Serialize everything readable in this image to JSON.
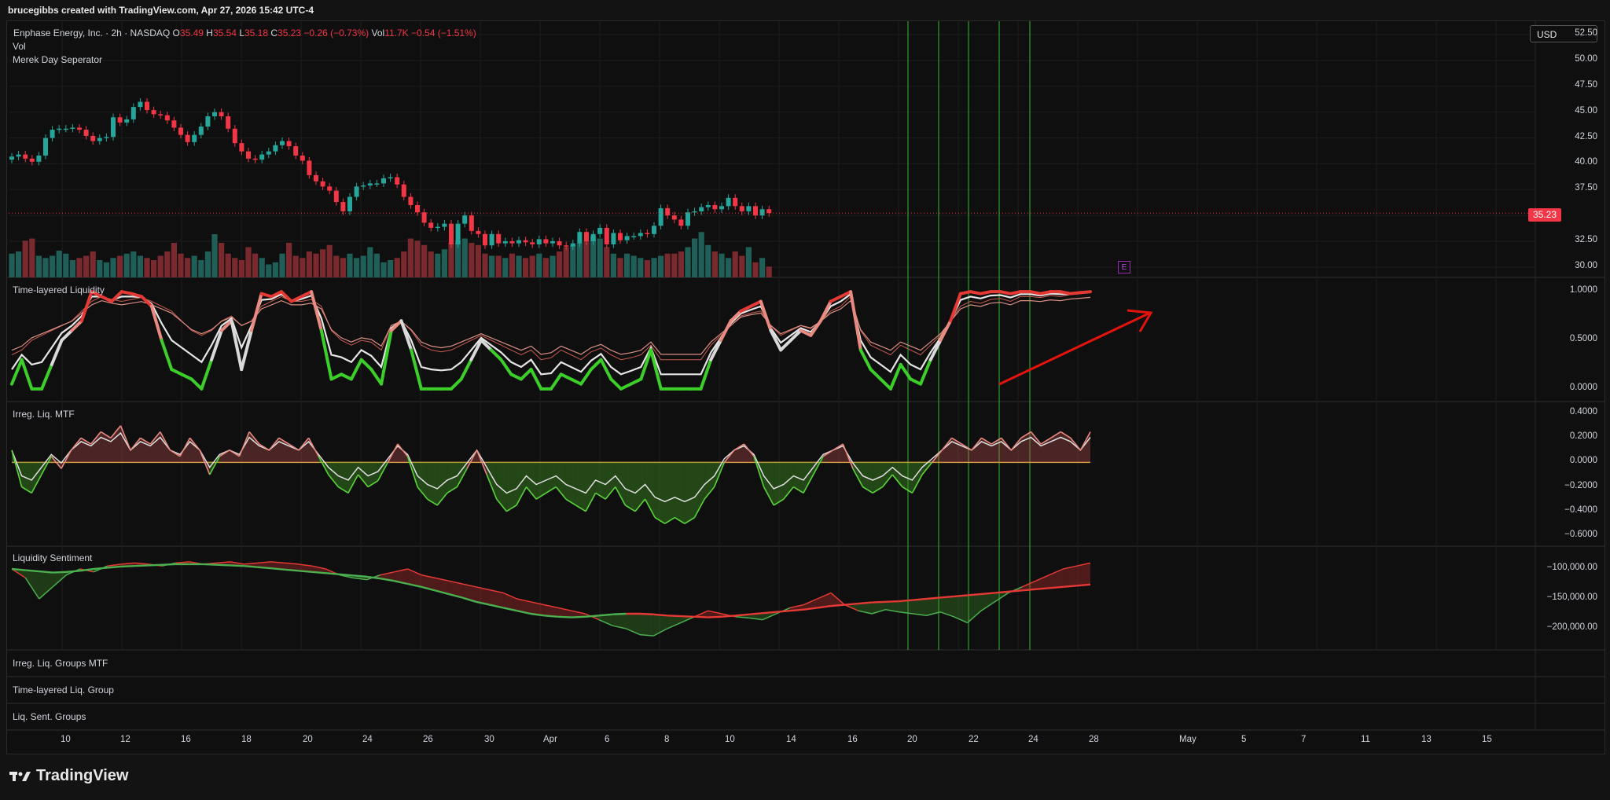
{
  "header": {
    "credit": "brucegibbs created with TradingView.com, Apr 27, 2026 15:42 UTC-4"
  },
  "symbol": {
    "name": "Enphase Energy, Inc. · 2h · NASDAQ",
    "o_label": "O",
    "o_value": "35.49",
    "h_label": "H",
    "h_value": "35.54",
    "l_label": "L",
    "l_value": "35.18",
    "c_label": "C",
    "c_value": "35.23",
    "change": "−0.26 (−0.73%)",
    "vol_label": "Vol",
    "vol_value": "11.7K",
    "vol_change": "−0.54 (−1.51%)"
  },
  "indicators": {
    "vol": "Vol",
    "day_sep": "Merek Day Seperator",
    "pane2": "Time-layered Liquidity",
    "pane3": "Irreg. Liq. MTF",
    "pane4": "Liquidity Sentiment",
    "pane5": "Irreg. Liq. Groups MTF",
    "pane6": "Time-layered Liq. Group",
    "pane7": "Liq. Sent. Groups"
  },
  "currency": "USD",
  "last_price": "35.23",
  "earnings_badge": "E",
  "footer": {
    "brand": "TradingView"
  },
  "colors": {
    "up": "#26a69a",
    "down": "#f23645",
    "green_line": "#4caf50",
    "red_line": "#e53935",
    "separator": "#2e9e2e"
  },
  "price_axis": [
    "52.50",
    "50.00",
    "47.50",
    "45.00",
    "42.50",
    "40.00",
    "37.50",
    "32.50",
    "30.00"
  ],
  "tl_axis": [
    "1.0000",
    "0.5000",
    "0.0000"
  ],
  "il_axis": [
    "0.4000",
    "0.2000",
    "0.0000",
    "−0.2000",
    "−0.4000",
    "−0.6000"
  ],
  "ls_axis": [
    "−100,000.00",
    "−150,000.00",
    "−200,000.00"
  ],
  "time_axis": [
    "10",
    "12",
    "16",
    "18",
    "20",
    "24",
    "26",
    "30",
    "Apr",
    "6",
    "8",
    "10",
    "14",
    "16",
    "20",
    "22",
    "24",
    "28",
    "May",
    "5",
    "7",
    "11",
    "13",
    "15"
  ],
  "chart_data": {
    "type": "candlestick",
    "title": "Enphase Energy, Inc. · 2h · NASDAQ",
    "xlabel": "",
    "ylabel": "",
    "ylim": [
      29.0,
      53.5
    ],
    "close": [
      40.7,
      40.9,
      40.5,
      40.2,
      40.8,
      42.5,
      43.3,
      43.4,
      43.4,
      43.5,
      43.3,
      42.7,
      42.2,
      42.5,
      42.6,
      44.5,
      44.0,
      44.3,
      45.5,
      46.0,
      45.2,
      44.8,
      44.7,
      44.2,
      43.5,
      42.8,
      42.1,
      42.8,
      43.6,
      44.6,
      45.0,
      44.6,
      43.4,
      42.0,
      41.2,
      40.5,
      40.4,
      40.9,
      41.2,
      41.8,
      42.2,
      41.7,
      40.8,
      40.3,
      38.9,
      38.3,
      37.8,
      37.4,
      36.3,
      35.4,
      36.8,
      37.8,
      37.9,
      38.1,
      38.1,
      38.6,
      38.7,
      38.0,
      36.8,
      36.0,
      35.3,
      34.3,
      33.8,
      33.9,
      34.2,
      32.2,
      34.2,
      35.0,
      33.5,
      33.2,
      32.1,
      33.2,
      32.3,
      32.5,
      32.3,
      32.6,
      32.4,
      32.2,
      32.7,
      32.3,
      32.5,
      32.1,
      32.0,
      32.3,
      33.4,
      32.5,
      33.2,
      33.8,
      32.2,
      33.3,
      32.6,
      33.0,
      33.0,
      33.3,
      33.2,
      34.0,
      35.7,
      35.0,
      34.6,
      34.0,
      35.3,
      35.4,
      35.8,
      36.0,
      35.6,
      35.9,
      36.7,
      35.9,
      35.4,
      35.9,
      35.0,
      35.6,
      35.23
    ],
    "volume_relative": [
      0.55,
      0.6,
      0.85,
      0.9,
      0.5,
      0.45,
      0.5,
      0.62,
      0.55,
      0.4,
      0.45,
      0.5,
      0.6,
      0.4,
      0.35,
      0.45,
      0.5,
      0.55,
      0.6,
      0.5,
      0.45,
      0.4,
      0.5,
      0.6,
      0.8,
      0.55,
      0.45,
      0.5,
      0.4,
      0.6,
      1.0,
      0.8,
      0.55,
      0.45,
      0.4,
      0.7,
      0.55,
      0.45,
      0.3,
      0.35,
      0.55,
      0.8,
      0.5,
      0.45,
      0.6,
      0.55,
      0.65,
      0.75,
      0.5,
      0.45,
      0.55,
      0.45,
      0.5,
      0.7,
      0.55,
      0.35,
      0.4,
      0.45,
      0.6,
      0.9,
      0.85,
      0.75,
      0.6,
      0.55,
      0.65,
      0.8,
      0.85,
      0.9,
      0.8,
      0.75,
      0.55,
      0.5,
      0.5,
      0.45,
      0.55,
      0.5,
      0.45,
      0.5,
      0.55,
      0.45,
      0.5,
      0.6,
      0.7,
      0.75,
      0.8,
      0.85,
      0.95,
      0.9,
      0.7,
      0.55,
      0.45,
      0.55,
      0.5,
      0.45,
      0.4,
      0.45,
      0.5,
      0.55,
      0.55,
      0.6,
      0.7,
      0.9,
      1.05,
      0.75,
      0.6,
      0.55,
      0.45,
      0.6,
      0.5,
      0.7,
      0.35,
      0.45,
      0.25
    ],
    "last_price": 35.23,
    "separator_dates": [
      "20",
      "21",
      "22",
      "23",
      "24"
    ],
    "time_layered_liquidity": {
      "ylim": [
        -0.05,
        1.05
      ],
      "thick": [
        0.05,
        0.3,
        0.0,
        0.0,
        0.25,
        0.5,
        0.6,
        0.7,
        1.0,
        0.95,
        0.9,
        1.0,
        0.98,
        0.95,
        0.85,
        0.5,
        0.2,
        0.15,
        0.1,
        0.0,
        0.3,
        0.6,
        0.7,
        0.2,
        0.6,
        0.98,
        0.95,
        1.0,
        0.9,
        0.95,
        1.0,
        0.6,
        0.1,
        0.15,
        0.1,
        0.3,
        0.2,
        0.05,
        0.6,
        0.7,
        0.4,
        0.0,
        0.0,
        0.0,
        0.0,
        0.1,
        0.3,
        0.5,
        0.4,
        0.3,
        0.15,
        0.1,
        0.2,
        0.0,
        0.0,
        0.15,
        0.1,
        0.05,
        0.2,
        0.3,
        0.1,
        0.0,
        0.05,
        0.1,
        0.4,
        0.0,
        0.0,
        0.0,
        0.0,
        0.0,
        0.3,
        0.5,
        0.7,
        0.8,
        0.85,
        0.9,
        0.6,
        0.4,
        0.5,
        0.6,
        0.55,
        0.7,
        0.9,
        0.95,
        1.0,
        0.4,
        0.2,
        0.1,
        0.0,
        0.25,
        0.1,
        0.05,
        0.3,
        0.5,
        0.7,
        0.98,
        1.0,
        0.98,
        1.0,
        1.0,
        0.98,
        1.0,
        1.0,
        0.98,
        1.0,
        1.0,
        0.98,
        0.99,
        1.0
      ],
      "thin_a": [
        0.35,
        0.4,
        0.5,
        0.55,
        0.6,
        0.65,
        0.7,
        0.8,
        0.9,
        0.95,
        0.92,
        0.9,
        0.92,
        0.94,
        0.9,
        0.85,
        0.8,
        0.7,
        0.6,
        0.55,
        0.6,
        0.7,
        0.75,
        0.65,
        0.7,
        0.85,
        0.9,
        0.95,
        0.9,
        0.9,
        0.92,
        0.85,
        0.6,
        0.5,
        0.45,
        0.5,
        0.48,
        0.4,
        0.65,
        0.7,
        0.6,
        0.45,
        0.4,
        0.38,
        0.4,
        0.45,
        0.5,
        0.55,
        0.5,
        0.45,
        0.4,
        0.35,
        0.4,
        0.3,
        0.32,
        0.4,
        0.35,
        0.3,
        0.38,
        0.42,
        0.35,
        0.3,
        0.32,
        0.35,
        0.45,
        0.3,
        0.3,
        0.3,
        0.3,
        0.3,
        0.45,
        0.55,
        0.65,
        0.75,
        0.78,
        0.8,
        0.65,
        0.55,
        0.6,
        0.65,
        0.62,
        0.7,
        0.8,
        0.85,
        0.95,
        0.6,
        0.45,
        0.4,
        0.35,
        0.45,
        0.4,
        0.35,
        0.45,
        0.55,
        0.7,
        0.85,
        0.9,
        0.88,
        0.92,
        0.93,
        0.9,
        0.95,
        0.95,
        0.94,
        0.96,
        0.95,
        0.97,
        0.98,
        0.99
      ]
    },
    "irreg_liq_mtf": {
      "ylim": [
        -0.62,
        0.42
      ],
      "main": [
        0.1,
        -0.2,
        -0.25,
        -0.1,
        0.05,
        -0.05,
        0.1,
        0.2,
        0.15,
        0.25,
        0.2,
        0.3,
        0.1,
        0.2,
        0.15,
        0.25,
        0.1,
        0.05,
        0.2,
        0.1,
        -0.1,
        0.05,
        0.1,
        0.05,
        0.25,
        0.15,
        0.1,
        0.2,
        0.15,
        0.1,
        0.2,
        0.05,
        -0.1,
        -0.2,
        -0.25,
        -0.1,
        -0.2,
        -0.15,
        0.0,
        0.15,
        0.05,
        -0.2,
        -0.3,
        -0.35,
        -0.25,
        -0.2,
        -0.05,
        0.1,
        -0.1,
        -0.3,
        -0.4,
        -0.35,
        -0.2,
        -0.3,
        -0.25,
        -0.2,
        -0.3,
        -0.35,
        -0.4,
        -0.25,
        -0.3,
        -0.2,
        -0.35,
        -0.4,
        -0.3,
        -0.45,
        -0.5,
        -0.45,
        -0.5,
        -0.45,
        -0.3,
        -0.2,
        0.0,
        0.1,
        0.15,
        0.05,
        -0.2,
        -0.35,
        -0.3,
        -0.2,
        -0.25,
        -0.1,
        0.05,
        0.1,
        0.15,
        -0.05,
        -0.2,
        -0.25,
        -0.2,
        -0.1,
        -0.2,
        -0.25,
        -0.1,
        0.0,
        0.1,
        0.2,
        0.15,
        0.1,
        0.2,
        0.15,
        0.2,
        0.1,
        0.2,
        0.25,
        0.15,
        0.2,
        0.25,
        0.2,
        0.1,
        0.25
      ]
    },
    "liquidity_sentiment": {
      "ylim": [
        -225000,
        -75000
      ],
      "fast": [
        -100000,
        -115000,
        -150000,
        -130000,
        -110000,
        -100000,
        -105000,
        -95000,
        -92000,
        -90000,
        -92000,
        -95000,
        -90000,
        -88000,
        -92000,
        -90000,
        -88000,
        -92000,
        -90000,
        -88000,
        -90000,
        -92000,
        -95000,
        -100000,
        -110000,
        -115000,
        -118000,
        -110000,
        -105000,
        -100000,
        -110000,
        -115000,
        -120000,
        -125000,
        -130000,
        -135000,
        -140000,
        -150000,
        -155000,
        -160000,
        -165000,
        -170000,
        -175000,
        -185000,
        -195000,
        -200000,
        -210000,
        -212000,
        -200000,
        -190000,
        -180000,
        -170000,
        -175000,
        -180000,
        -182000,
        -185000,
        -175000,
        -165000,
        -160000,
        -150000,
        -140000,
        -160000,
        -170000,
        -175000,
        -168000,
        -172000,
        -175000,
        -178000,
        -172000,
        -180000,
        -190000,
        -170000,
        -155000,
        -140000,
        -130000,
        -120000,
        -110000,
        -100000,
        -95000,
        -90000
      ],
      "slow": [
        -100000,
        -102000,
        -104000,
        -106000,
        -105000,
        -103000,
        -100000,
        -98000,
        -96000,
        -95000,
        -94000,
        -93000,
        -92000,
        -92000,
        -92000,
        -93000,
        -94000,
        -95000,
        -97000,
        -99000,
        -101000,
        -103000,
        -105000,
        -107000,
        -109000,
        -111000,
        -113000,
        -116000,
        -120000,
        -125000,
        -130000,
        -136000,
        -142000,
        -148000,
        -155000,
        -160000,
        -165000,
        -170000,
        -175000,
        -178000,
        -180000,
        -181000,
        -180000,
        -178000,
        -176000,
        -175000,
        -175000,
        -176000,
        -178000,
        -179000,
        -180000,
        -181000,
        -180000,
        -178000,
        -176000,
        -174000,
        -172000,
        -170000,
        -168000,
        -165000,
        -162000,
        -160000,
        -158000,
        -156000,
        -155000,
        -154000,
        -152000,
        -150000,
        -148000,
        -146000,
        -144000,
        -142000,
        -140000,
        -138000,
        -136000,
        -134000,
        -132000,
        -130000,
        -128000,
        -126000
      ]
    }
  }
}
